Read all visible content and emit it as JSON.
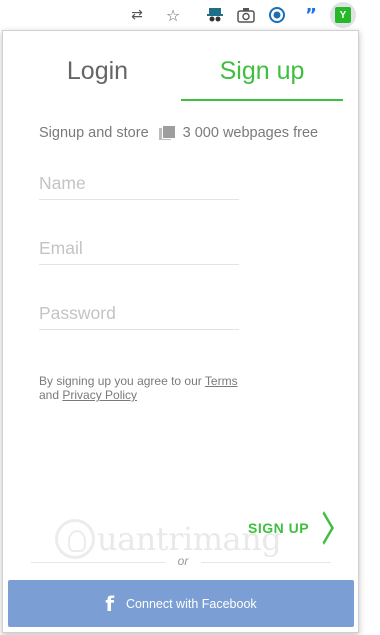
{
  "toolbar": {
    "icons": [
      "translate-icon",
      "star-icon",
      "incognito-icon",
      "camera-icon",
      "record-icon",
      "quote-icon",
      "extension-icon"
    ],
    "extension_letter": "Y",
    "accent": "#27b827"
  },
  "tabs": {
    "login": "Login",
    "signup": "Sign up",
    "active": "signup"
  },
  "promo": {
    "text": "Signup and store",
    "quota": "3 000 webpages free"
  },
  "form": {
    "name_placeholder": "Name",
    "email_placeholder": "Email",
    "password_placeholder": "Password",
    "name_value": "",
    "email_value": "",
    "password_value": ""
  },
  "terms": {
    "prefix": "By signing up you agree to our",
    "terms_link": "Terms",
    "and": "and",
    "privacy_link": "Privacy Policy"
  },
  "watermark": {
    "text": "uantrimang"
  },
  "actions": {
    "signup_label": "SIGN UP",
    "or_label": "or",
    "facebook_label": "Connect with Facebook",
    "facebook_color": "#7b9fd4",
    "accent": "#3fbf3f"
  }
}
